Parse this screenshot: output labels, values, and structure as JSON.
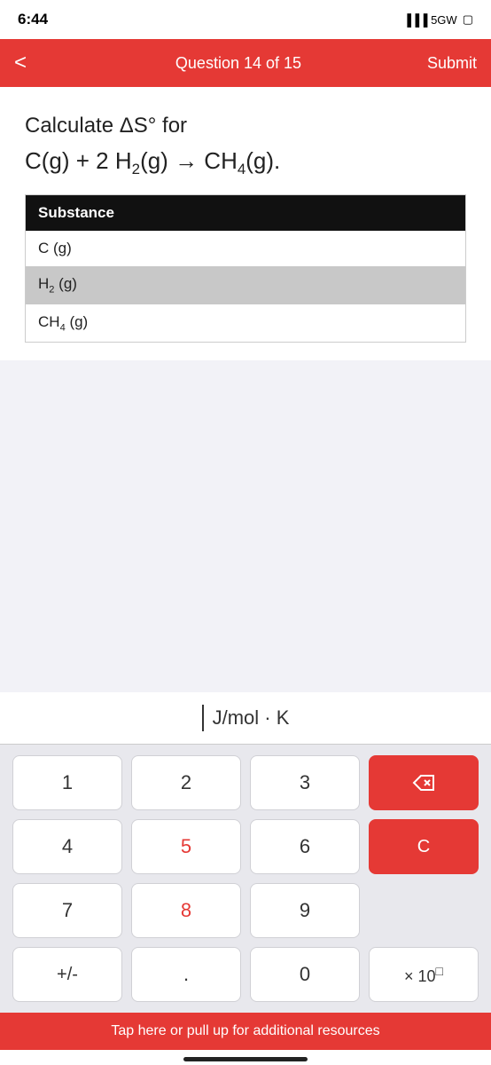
{
  "status": {
    "time": "6:44",
    "signal": "5GW",
    "battery_icon": "🔲"
  },
  "nav": {
    "back_label": "<",
    "title": "Question 14 of 15",
    "submit_label": "Submit"
  },
  "question": {
    "instruction": "Calculate ΔS° for",
    "equation_text": "C(g) + 2 H₂(g) → CH₄(g)."
  },
  "table": {
    "header": "Substance",
    "rows": [
      {
        "substance": "C (g)"
      },
      {
        "substance": "H₂ (g)"
      },
      {
        "substance": "CH₄ (g)"
      }
    ]
  },
  "calculator": {
    "display_unit": "J/mol · K",
    "keys": {
      "1": "1",
      "2": "2",
      "3": "3",
      "4": "4",
      "5": "5",
      "6": "6",
      "7": "7",
      "8": "8",
      "9": "9",
      "plus_minus": "+/-",
      "dot": ".",
      "zero": "0",
      "backspace": "⌫",
      "clear": "C",
      "x10": "× 10□"
    }
  },
  "bottom_banner": {
    "text": "Tap here or pull up for additional resources"
  }
}
